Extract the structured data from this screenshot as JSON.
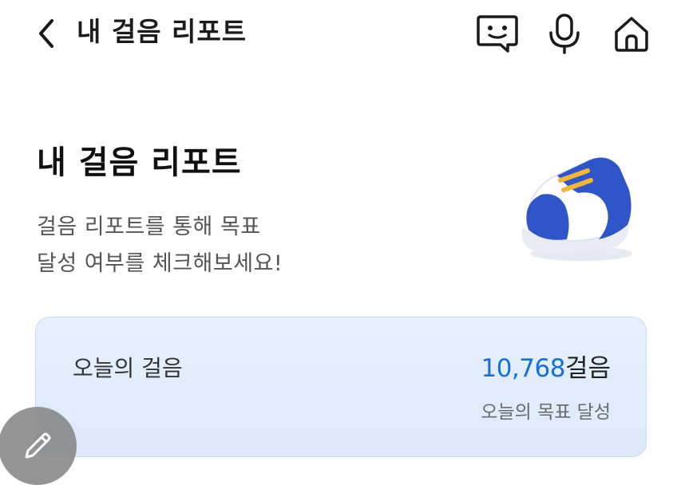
{
  "header": {
    "title": "내 걸음 리포트",
    "back_icon": "chevron-left-icon",
    "actions": [
      {
        "name": "chat-icon"
      },
      {
        "name": "microphone-icon"
      },
      {
        "name": "home-icon"
      }
    ]
  },
  "hero": {
    "title": "내 걸음 리포트",
    "description_line1": "걸음 리포트를 통해 목표",
    "description_line2": "달성 여부를 체크해보세요!",
    "illustration_icon": "sneaker-icon"
  },
  "steps_card": {
    "label": "오늘의 걸음",
    "count": "10,768",
    "unit": "걸음",
    "status": "오늘의 목표 달성"
  },
  "fab": {
    "icon": "pencil-icon"
  },
  "colors": {
    "accent": "#1670d6",
    "card_bg": "#e3eefc",
    "shoe_blue": "#2f55c8",
    "lace_yellow": "#f2b73a"
  }
}
